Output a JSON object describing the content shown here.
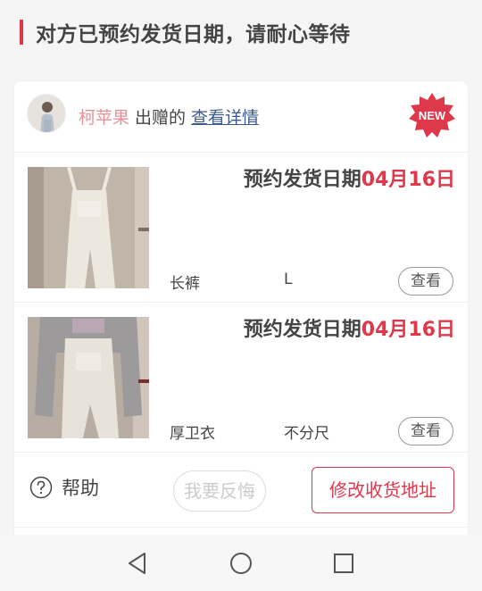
{
  "header": {
    "title": "对方已预约发货日期，请耐心等待"
  },
  "giver": {
    "name": "柯苹果",
    "suffix": "出赠的",
    "detail_link": "查看详情",
    "badge": "NEW"
  },
  "items": [
    {
      "ship_label": "预约发货日期",
      "ship_date": "04月16日",
      "category": "长裤",
      "size": "L",
      "view_label": "查看"
    },
    {
      "ship_label": "预约发货日期",
      "ship_date": "04月16日",
      "category": "厚卫衣",
      "size": "不分尺",
      "view_label": "查看"
    }
  ],
  "actions": {
    "help_label": "帮助",
    "regret_label": "我要反悔",
    "change_address_label": "修改收货地址"
  },
  "colors": {
    "accent": "#e0384b",
    "giver_name": "#e89298",
    "link": "#3d5a8c"
  },
  "icons": {
    "help": "question-circle-icon",
    "new_badge": "new-starburst-icon",
    "nav_back": "triangle-back-icon",
    "nav_home": "circle-home-icon",
    "nav_recent": "square-recent-icon"
  }
}
